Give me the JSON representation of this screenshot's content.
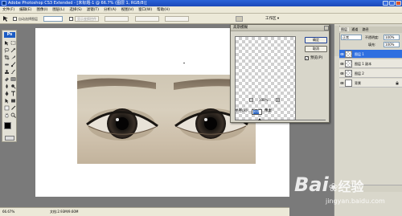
{
  "window": {
    "title": "Adobe Photoshop CS3 Extended - [未标题-1 @ 66.7% (图层 1, RGB/8)]"
  },
  "menu": [
    "文件(F)",
    "编辑(E)",
    "图像(I)",
    "图层(L)",
    "选择(S)",
    "滤镜(T)",
    "分析(A)",
    "视图(V)",
    "窗口(W)",
    "帮助(H)"
  ],
  "options": {
    "auto_select_label": "自动选择图层",
    "transform_label": "显示变换控件",
    "workspace_label": "工作区 ▾",
    "zoom_value": "100%"
  },
  "tools": {
    "logo": "Ps"
  },
  "document": {
    "status_zoom": "66.67%",
    "status_doc": "文档:2.93M/9.60M"
  },
  "dialog": {
    "title": "高斯模糊",
    "ok_label": "确定",
    "cancel_label": "取消",
    "preview_label": "预览(P)",
    "preview_checked": true,
    "preview_zoom": "100%",
    "radius_label": "半径(R):",
    "radius_value": "3.0",
    "radius_unit": "像素"
  },
  "layers": {
    "tabs": [
      "图层",
      "通道",
      "路径"
    ],
    "blend_mode": "正常",
    "opacity_label": "不透明度:",
    "opacity_value": "100%",
    "fill_label": "填充:",
    "fill_value": "100%",
    "rows": [
      {
        "name": "图层 1",
        "selected": true
      },
      {
        "name": "图层 1 副本",
        "selected": false
      },
      {
        "name": "图层 2",
        "selected": false
      },
      {
        "name": "背景",
        "selected": false
      }
    ]
  },
  "watermark": {
    "brand": "Bai",
    "brand_tail": "经验",
    "url": "jingyan.baidu.com"
  }
}
